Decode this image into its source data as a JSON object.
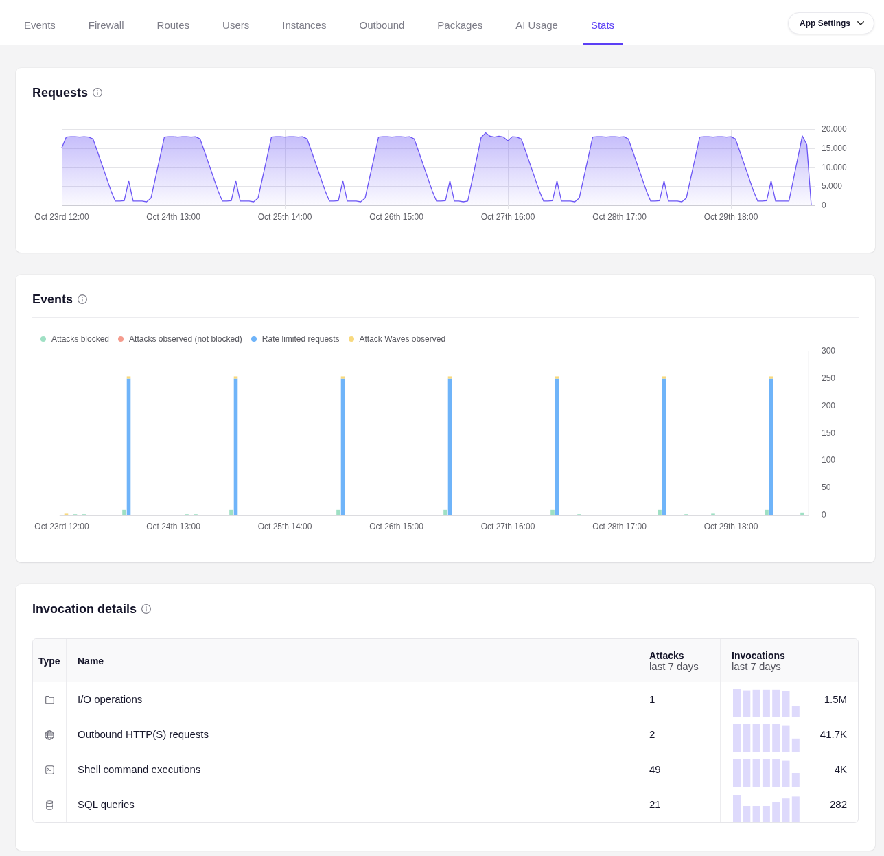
{
  "nav": {
    "tabs": [
      {
        "label": "Events",
        "selected": false
      },
      {
        "label": "Firewall",
        "selected": false
      },
      {
        "label": "Routes",
        "selected": false
      },
      {
        "label": "Users",
        "selected": false
      },
      {
        "label": "Instances",
        "selected": false
      },
      {
        "label": "Outbound",
        "selected": false
      },
      {
        "label": "Packages",
        "selected": false
      },
      {
        "label": "AI Usage",
        "selected": false
      },
      {
        "label": "Stats",
        "selected": true
      }
    ],
    "settings_button": {
      "label": "App Settings"
    }
  },
  "requests": {
    "title": "Requests",
    "chart_data": {
      "type": "area",
      "grid": true,
      "categories": [
        "Oct 23rd 12:00",
        null,
        null,
        null,
        null,
        null,
        null,
        null,
        null,
        null,
        null,
        null,
        null,
        null,
        null,
        null,
        null,
        null,
        null,
        null,
        null,
        null,
        null,
        null,
        null,
        "Oct 24th 13:00",
        null,
        null,
        null,
        null,
        null,
        null,
        null,
        null,
        null,
        null,
        null,
        null,
        null,
        null,
        null,
        null,
        null,
        null,
        null,
        null,
        null,
        null,
        null,
        null,
        "Oct 25th 14:00",
        null,
        null,
        null,
        null,
        null,
        null,
        null,
        null,
        null,
        null,
        null,
        null,
        null,
        null,
        null,
        null,
        null,
        null,
        null,
        null,
        null,
        null,
        null,
        null,
        "Oct 26th 15:00",
        null,
        null,
        null,
        null,
        null,
        null,
        null,
        null,
        null,
        null,
        null,
        null,
        null,
        null,
        null,
        null,
        null,
        null,
        null,
        null,
        null,
        null,
        null,
        null,
        "Oct 27th 16:00",
        null,
        null,
        null,
        null,
        null,
        null,
        null,
        null,
        null,
        null,
        null,
        null,
        null,
        null,
        null,
        null,
        null,
        null,
        null,
        null,
        null,
        null,
        null,
        null,
        "Oct 28th 17:00",
        null,
        null,
        null,
        null,
        null,
        null,
        null,
        null,
        null,
        null,
        null,
        null,
        null,
        null,
        null,
        null,
        null,
        null,
        null,
        null,
        null,
        null,
        null,
        null,
        "Oct 29th 18:00",
        null,
        null,
        null,
        null,
        null,
        null,
        null,
        null,
        null,
        null,
        null,
        null,
        null,
        null,
        null,
        null,
        null,
        null
      ],
      "series": [
        {
          "color": "#6b55f5",
          "values": [
            15.1,
            17.9,
            18,
            18,
            17.9,
            18,
            17.9,
            17.4,
            14.1,
            10.7,
            7.3,
            3.9,
            1.1,
            1.1,
            1.2,
            6.4,
            1.1,
            1.1,
            1.1,
            0.9,
            1.9,
            7.2,
            12.5,
            17.9,
            18,
            18,
            17.9,
            18,
            18,
            17.9,
            18,
            17.4,
            14.1,
            10.7,
            7.3,
            3.9,
            1.1,
            1.1,
            1.2,
            6.4,
            1.1,
            1.1,
            1.1,
            0.9,
            1.9,
            7.2,
            12.5,
            17.9,
            18,
            18,
            17.9,
            18,
            18,
            17.9,
            18,
            17.4,
            14.1,
            10.7,
            7.3,
            3.9,
            1.1,
            1.1,
            1.2,
            6.4,
            1.1,
            1.1,
            1.1,
            0.9,
            1.9,
            7.2,
            12.5,
            17.9,
            18,
            18,
            17.9,
            18,
            18,
            17.9,
            18,
            17.4,
            14.1,
            10.7,
            7.3,
            3.9,
            1.1,
            1.1,
            1.2,
            6.4,
            1.1,
            1.1,
            0.9,
            1.1,
            6.6,
            12.2,
            17.8,
            19,
            18.1,
            17.9,
            18.1,
            17.9,
            16.9,
            18,
            17.9,
            17.4,
            14.1,
            10.7,
            7.3,
            3.9,
            1.1,
            1.1,
            1.2,
            6.4,
            1.1,
            1.1,
            1.1,
            0.9,
            1.9,
            7.2,
            12.5,
            17.9,
            18,
            18,
            17.9,
            18,
            18,
            17.9,
            18,
            17.4,
            14.1,
            10.7,
            7.3,
            3.9,
            1.1,
            1.1,
            1.2,
            6.4,
            1.1,
            1.1,
            1.1,
            0.9,
            1.9,
            7.2,
            12.5,
            17.9,
            18,
            18,
            17.9,
            18,
            18,
            17.9,
            18,
            17.4,
            14.1,
            10.7,
            7.3,
            3.9,
            1.1,
            1.1,
            1.2,
            6.4,
            1.1,
            1.1,
            1.1,
            1.1,
            6.8,
            12.5,
            18.2,
            15.9,
            0
          ]
        }
      ],
      "ylim": [
        0,
        20
      ],
      "yticks": [
        0,
        {
          "value": 5,
          "label": "5.000"
        },
        {
          "value": 10,
          "label": "10.000"
        },
        {
          "value": 15,
          "label": "15.000"
        },
        {
          "value": 20,
          "label": "20.000"
        }
      ]
    }
  },
  "events": {
    "title": "Events",
    "chart_data": {
      "type": "bar",
      "stacked": true,
      "legend": "top",
      "categories": [
        "Oct 23rd 12:00",
        null,
        null,
        null,
        null,
        null,
        null,
        null,
        null,
        null,
        null,
        null,
        null,
        null,
        null,
        null,
        null,
        null,
        null,
        null,
        null,
        null,
        null,
        null,
        null,
        "Oct 24th 13:00",
        null,
        null,
        null,
        null,
        null,
        null,
        null,
        null,
        null,
        null,
        null,
        null,
        null,
        null,
        null,
        null,
        null,
        null,
        null,
        null,
        null,
        null,
        null,
        null,
        "Oct 25th 14:00",
        null,
        null,
        null,
        null,
        null,
        null,
        null,
        null,
        null,
        null,
        null,
        null,
        null,
        null,
        null,
        null,
        null,
        null,
        null,
        null,
        null,
        null,
        null,
        null,
        "Oct 26th 15:00",
        null,
        null,
        null,
        null,
        null,
        null,
        null,
        null,
        null,
        null,
        null,
        null,
        null,
        null,
        null,
        null,
        null,
        null,
        null,
        null,
        null,
        null,
        null,
        null,
        "Oct 27th 16:00",
        null,
        null,
        null,
        null,
        null,
        null,
        null,
        null,
        null,
        null,
        null,
        null,
        null,
        null,
        null,
        null,
        null,
        null,
        null,
        null,
        null,
        null,
        null,
        null,
        "Oct 28th 17:00",
        null,
        null,
        null,
        null,
        null,
        null,
        null,
        null,
        null,
        null,
        null,
        null,
        null,
        null,
        null,
        null,
        null,
        null,
        null,
        null,
        null,
        null,
        null,
        null,
        "Oct 29th 18:00",
        null,
        null,
        null,
        null,
        null,
        null,
        null,
        null,
        null,
        null,
        null,
        null,
        null,
        null,
        null,
        null,
        null
      ],
      "series": [
        {
          "name": "Attacks blocked",
          "color": "#9fe0c4",
          "values": [
            0,
            0,
            0,
            1,
            0,
            1,
            0,
            0,
            0,
            0,
            0,
            0,
            0,
            0,
            9,
            0,
            0,
            0,
            0,
            0,
            0,
            0,
            0,
            0,
            0,
            0,
            0,
            0,
            1,
            0,
            1,
            0,
            0,
            0,
            0,
            0,
            0,
            0,
            9,
            0,
            0,
            0,
            0,
            0,
            0,
            0,
            0,
            0,
            0,
            0,
            0,
            0,
            0,
            0,
            0,
            0,
            0,
            0,
            0,
            0,
            0,
            0,
            9,
            0,
            0,
            0,
            0,
            0,
            0,
            0,
            0,
            0,
            0,
            0,
            0,
            0,
            0,
            0,
            0,
            0,
            0,
            0,
            0,
            0,
            0,
            0,
            9,
            0,
            0,
            0,
            0,
            0,
            0,
            0,
            0,
            0,
            0,
            0,
            0,
            0,
            0,
            0,
            0,
            0,
            0,
            0,
            0,
            0,
            0,
            0,
            9,
            0,
            0,
            0,
            0,
            0,
            1,
            0,
            0,
            0,
            0,
            0,
            0,
            0,
            0,
            0,
            0,
            0,
            0,
            0,
            0,
            0,
            0,
            0,
            9,
            0,
            0,
            0,
            0,
            0,
            1,
            0,
            0,
            0,
            0,
            0,
            2,
            0,
            0,
            0,
            0,
            0,
            0,
            0,
            0,
            0,
            0,
            0,
            9,
            0,
            0,
            0,
            0,
            0,
            0,
            0,
            4,
            0
          ]
        },
        {
          "name": "Attacks observed (not blocked)",
          "color": "#f59b8d",
          "values": [
            0,
            0,
            0,
            0,
            0,
            0,
            0,
            0,
            0,
            0,
            0,
            0,
            0,
            0,
            0,
            0,
            0,
            0,
            0,
            0,
            0,
            0,
            0,
            0,
            0,
            0,
            0,
            0,
            0,
            0,
            0,
            0,
            0,
            0,
            0,
            0,
            0,
            0,
            0,
            0,
            0,
            0,
            0,
            0,
            0,
            0,
            0,
            0,
            0,
            0,
            0,
            0,
            0,
            0,
            0,
            0,
            0,
            0,
            0,
            0,
            0,
            0,
            0,
            0,
            0,
            0,
            0,
            0,
            0,
            0,
            0,
            0,
            0,
            0,
            0,
            0,
            0,
            0,
            0,
            0,
            0,
            0,
            0,
            0,
            0,
            0,
            0,
            0,
            0,
            0,
            0,
            0,
            0,
            0,
            0,
            0,
            0,
            0,
            0,
            0,
            0,
            0,
            0,
            0,
            0,
            0,
            0,
            0,
            0,
            0,
            0,
            0,
            0,
            0,
            0,
            0,
            0,
            0,
            0,
            0,
            0,
            0,
            0,
            0,
            0,
            0,
            0,
            0,
            0,
            0,
            0,
            0,
            0,
            0,
            0,
            0,
            0,
            0,
            0,
            0,
            0,
            0,
            0,
            0,
            0,
            0,
            0,
            0,
            0,
            0,
            0,
            0,
            0,
            0,
            0,
            0,
            0,
            0,
            0,
            0,
            0,
            0,
            0,
            0,
            0,
            0,
            0,
            0
          ]
        },
        {
          "name": "Rate limited requests",
          "color": "#6fb4f9",
          "values": [
            0,
            0,
            0,
            0,
            0,
            0,
            0,
            0,
            0,
            0,
            0,
            0,
            0,
            0,
            0,
            249,
            0,
            0,
            0,
            0,
            0,
            0,
            0,
            0,
            0,
            0,
            0,
            0,
            0,
            0,
            0,
            0,
            0,
            0,
            0,
            0,
            0,
            0,
            0,
            249,
            0,
            0,
            0,
            0,
            0,
            0,
            0,
            0,
            0,
            0,
            0,
            0,
            0,
            0,
            0,
            0,
            0,
            0,
            0,
            0,
            0,
            0,
            0,
            249,
            0,
            0,
            0,
            0,
            0,
            0,
            0,
            0,
            0,
            0,
            0,
            0,
            0,
            0,
            0,
            0,
            0,
            0,
            0,
            0,
            0,
            0,
            0,
            249,
            0,
            0,
            0,
            0,
            0,
            0,
            0,
            0,
            0,
            0,
            0,
            0,
            0,
            0,
            0,
            0,
            0,
            0,
            0,
            0,
            0,
            0,
            0,
            249,
            0,
            0,
            0,
            0,
            0,
            0,
            0,
            0,
            0,
            0,
            0,
            0,
            0,
            0,
            0,
            0,
            0,
            0,
            0,
            0,
            0,
            0,
            0,
            249,
            0,
            0,
            0,
            0,
            0,
            0,
            0,
            0,
            0,
            0,
            0,
            0,
            0,
            0,
            0,
            0,
            0,
            0,
            0,
            0,
            0,
            0,
            0,
            249,
            0,
            0,
            0,
            0,
            0,
            0,
            0,
            0
          ]
        },
        {
          "name": "Attack Waves observed",
          "color": "#f8d97e",
          "values": [
            0,
            2,
            0,
            0,
            0,
            0,
            0,
            0,
            0,
            0,
            0,
            0,
            0,
            0,
            0,
            4,
            0,
            0,
            0,
            0,
            0,
            0,
            0,
            0,
            0,
            0,
            0,
            0,
            0,
            0,
            0,
            0,
            0,
            0,
            0,
            0,
            0,
            0,
            0,
            4,
            0,
            0,
            0,
            0,
            0,
            0,
            0,
            0,
            0,
            0,
            0,
            0,
            0,
            0,
            0,
            0,
            0,
            0,
            0,
            0,
            0,
            0,
            0,
            4,
            0,
            0,
            0,
            0,
            0,
            0,
            0,
            0,
            0,
            0,
            0,
            0,
            0,
            0,
            0,
            0,
            0,
            0,
            0,
            0,
            0,
            0,
            0,
            4,
            0,
            0,
            0,
            0,
            0,
            0,
            0,
            0,
            0,
            0,
            0,
            0,
            0,
            0,
            0,
            0,
            0,
            0,
            0,
            0,
            0,
            0,
            0,
            4,
            0,
            0,
            0,
            0,
            0,
            0,
            0,
            0,
            0,
            0,
            0,
            0,
            0,
            0,
            0,
            0,
            0,
            0,
            0,
            0,
            0,
            0,
            0,
            4,
            0,
            0,
            0,
            0,
            0,
            0,
            0,
            0,
            0,
            0,
            0,
            0,
            0,
            0,
            0,
            0,
            0,
            0,
            0,
            0,
            0,
            0,
            0,
            4,
            0,
            0,
            0,
            0,
            0,
            0,
            0,
            0
          ]
        }
      ],
      "ylim": [
        0,
        300
      ],
      "yticks": [
        0,
        50,
        100,
        150,
        200,
        250,
        300
      ]
    }
  },
  "invocations": {
    "title": "Invocation details",
    "columns": [
      {
        "label": "Type"
      },
      {
        "label": "Name"
      },
      {
        "label": "Attacks",
        "sublabel": "last 7 days"
      },
      {
        "label": "Invocations",
        "sublabel": "last 7 days"
      }
    ],
    "rows": [
      {
        "kind": "io",
        "name": "I/O operations",
        "attacks": "1",
        "invocations": "1.5M"
      },
      {
        "kind": "http",
        "name": "Outbound HTTP(S) requests",
        "attacks": "2",
        "invocations": "41.7K"
      },
      {
        "kind": "shell",
        "name": "Shell command executions",
        "attacks": "49",
        "invocations": "4K"
      },
      {
        "kind": "sql",
        "name": "SQL queries",
        "attacks": "21",
        "invocations": "282"
      }
    ]
  }
}
